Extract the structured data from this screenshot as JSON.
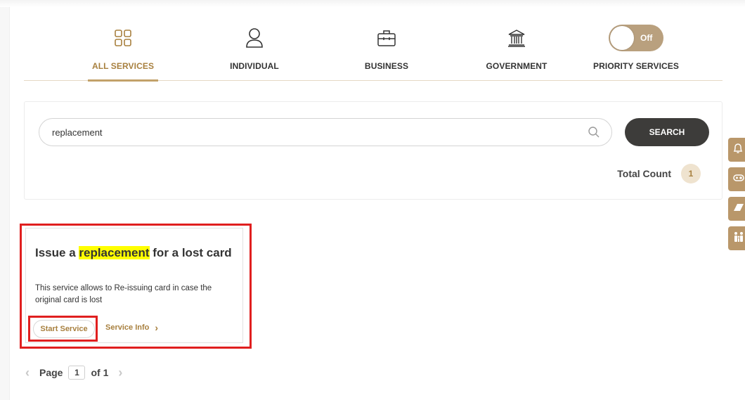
{
  "tabs": [
    {
      "label": "ALL SERVICES",
      "icon": "grid-icon",
      "active": true
    },
    {
      "label": "INDIVIDUAL",
      "icon": "person-icon",
      "active": false
    },
    {
      "label": "BUSINESS",
      "icon": "briefcase-icon",
      "active": false
    },
    {
      "label": "GOVERNMENT",
      "icon": "government-building-icon",
      "active": false
    },
    {
      "label": "PRIORITY SERVICES",
      "icon": "toggle",
      "active": false
    }
  ],
  "priority_toggle": {
    "state_label": "Off",
    "on": false
  },
  "search": {
    "value": "replacement",
    "placeholder": "",
    "button_label": "SEARCH"
  },
  "total_count": {
    "label": "Total Count",
    "value": "1"
  },
  "result_card": {
    "title_before": "Issue a ",
    "title_highlight": "replacement",
    "title_after": " for a lost card",
    "description": "This service allows to Re-issuing card in case the original card is lost",
    "start_label": "Start Service",
    "info_label": "Service Info"
  },
  "pagination": {
    "page_label": "Page",
    "current": "1",
    "of_label": "of 1"
  },
  "side_widgets": [
    "bell-icon",
    "gamepad-icon",
    "shapes-icon",
    "family-icon"
  ],
  "colors": {
    "accent_gold": "#a8803f",
    "toggle_bg": "#b9a07e",
    "search_button": "#3d3c3a",
    "highlight_red": "#e01f1f",
    "text_highlight": "#ffff00"
  }
}
